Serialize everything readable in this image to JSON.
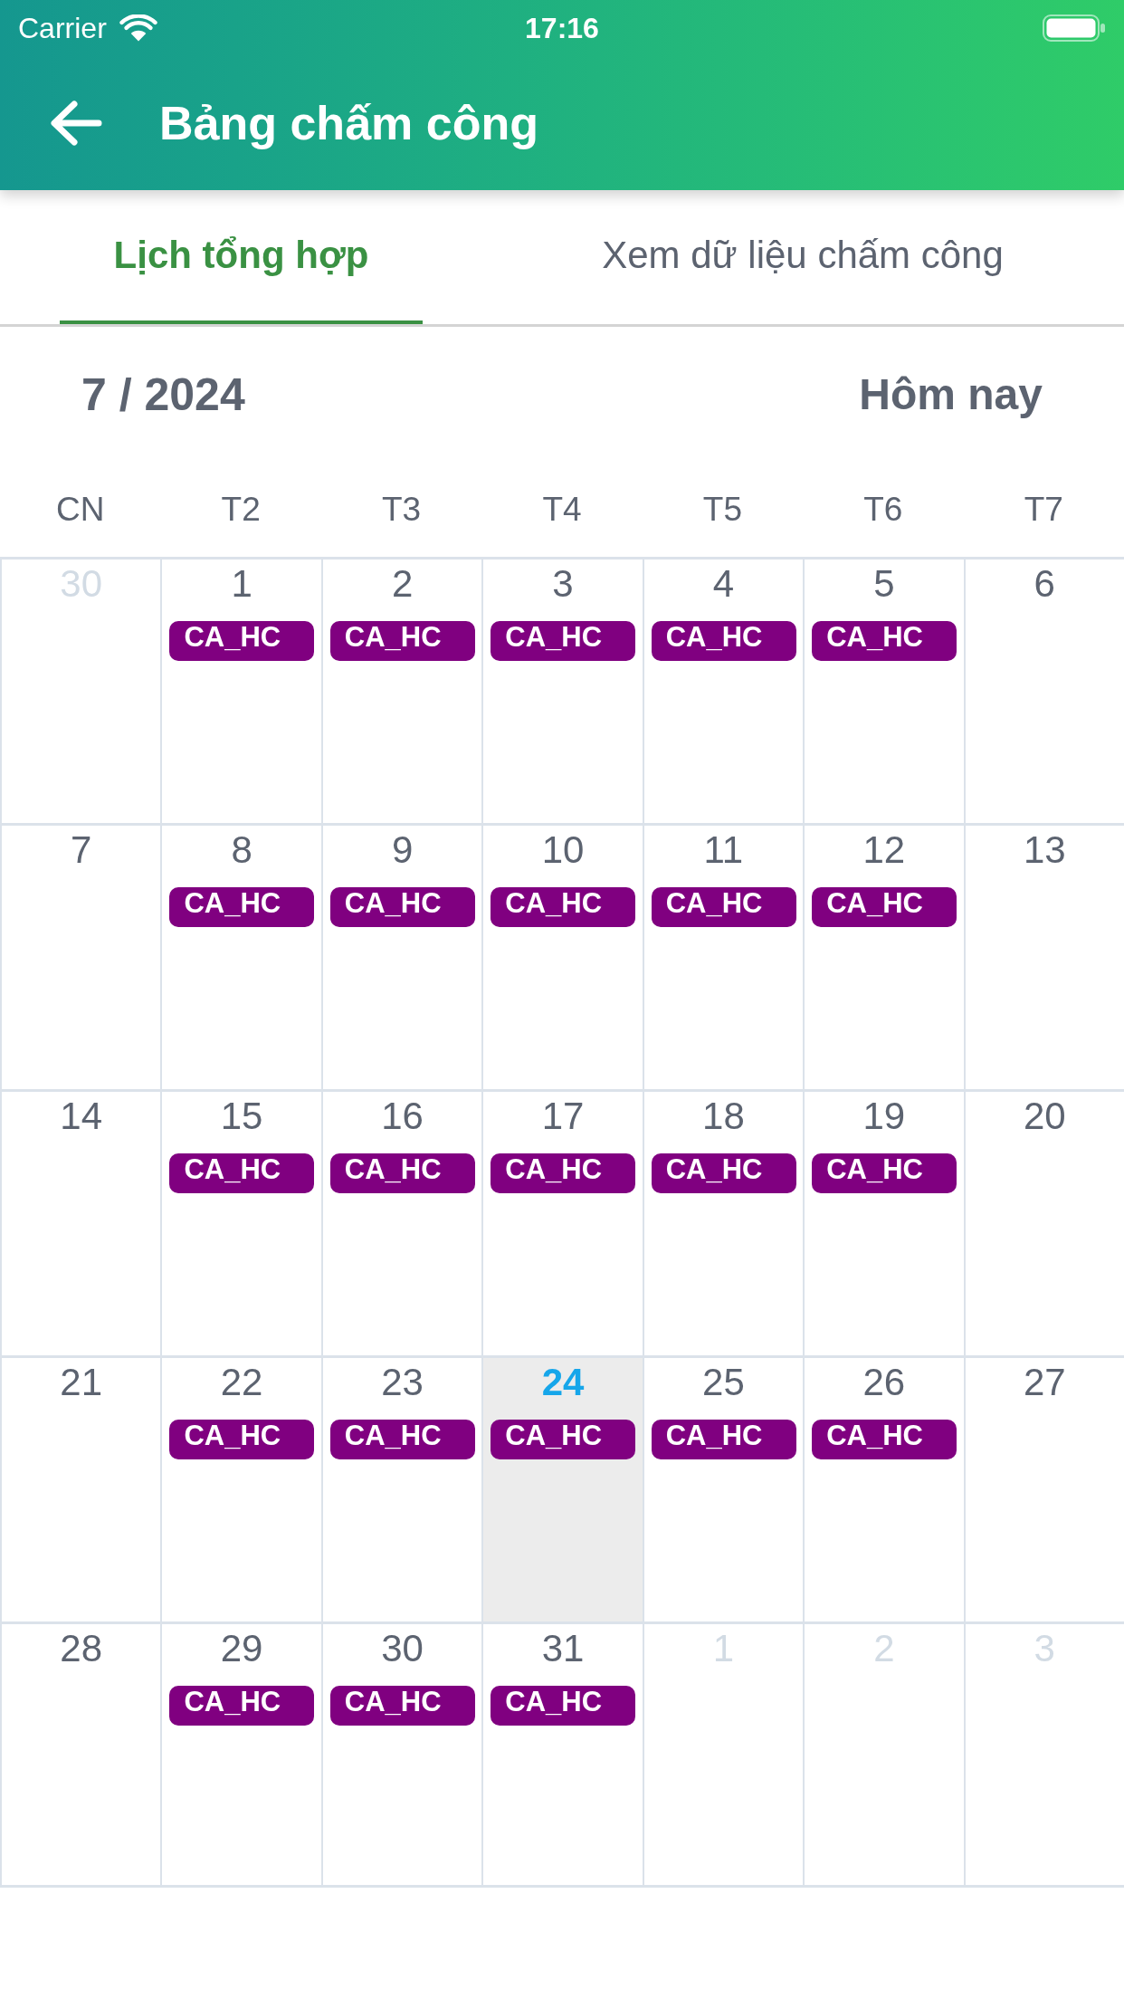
{
  "status_bar": {
    "carrier": "Carrier",
    "time": "17:16"
  },
  "header": {
    "title": "Bảng chấm công"
  },
  "tabs": [
    {
      "label": "Lịch tổng hợp",
      "selected": true
    },
    {
      "label": "Xem dữ liệu chấm công",
      "selected": false
    }
  ],
  "calendar": {
    "month": "7 / 2024",
    "today_button": "Hôm nay",
    "weekdays": [
      "CN",
      "T2",
      "T3",
      "T4",
      "T5",
      "T6",
      "T7"
    ],
    "weeks": [
      {
        "days": [
          {
            "day": "30",
            "in_month": false,
            "today": false
          },
          {
            "day": "1",
            "in_month": true,
            "today": false,
            "shifts": [
              "CA_HC"
            ]
          },
          {
            "day": "2",
            "in_month": true,
            "today": false,
            "shifts": [
              "CA_HC"
            ]
          },
          {
            "day": "3",
            "in_month": true,
            "today": false,
            "shifts": [
              "CA_HC"
            ]
          },
          {
            "day": "4",
            "in_month": true,
            "today": false,
            "shifts": [
              "CA_HC"
            ]
          },
          {
            "day": "5",
            "in_month": true,
            "today": false,
            "shifts": [
              "CA_HC"
            ]
          },
          {
            "day": "6",
            "in_month": true,
            "today": false
          }
        ]
      },
      {
        "days": [
          {
            "day": "7",
            "in_month": true,
            "today": false
          },
          {
            "day": "8",
            "in_month": true,
            "today": false,
            "shifts": [
              "CA_HC"
            ]
          },
          {
            "day": "9",
            "in_month": true,
            "today": false,
            "shifts": [
              "CA_HC"
            ]
          },
          {
            "day": "10",
            "in_month": true,
            "today": false,
            "shifts": [
              "CA_HC"
            ]
          },
          {
            "day": "11",
            "in_month": true,
            "today": false,
            "shifts": [
              "CA_HC"
            ]
          },
          {
            "day": "12",
            "in_month": true,
            "today": false,
            "shifts": [
              "CA_HC"
            ]
          },
          {
            "day": "13",
            "in_month": true,
            "today": false
          }
        ]
      },
      {
        "days": [
          {
            "day": "14",
            "in_month": true,
            "today": false
          },
          {
            "day": "15",
            "in_month": true,
            "today": false,
            "shifts": [
              "CA_HC"
            ]
          },
          {
            "day": "16",
            "in_month": true,
            "today": false,
            "shifts": [
              "CA_HC"
            ]
          },
          {
            "day": "17",
            "in_month": true,
            "today": false,
            "shifts": [
              "CA_HC"
            ]
          },
          {
            "day": "18",
            "in_month": true,
            "today": false,
            "shifts": [
              "CA_HC"
            ]
          },
          {
            "day": "19",
            "in_month": true,
            "today": false,
            "shifts": [
              "CA_HC"
            ]
          },
          {
            "day": "20",
            "in_month": true,
            "today": false
          }
        ]
      },
      {
        "days": [
          {
            "day": "21",
            "in_month": true,
            "today": false
          },
          {
            "day": "22",
            "in_month": true,
            "today": false,
            "shifts": [
              "CA_HC"
            ]
          },
          {
            "day": "23",
            "in_month": true,
            "today": false,
            "shifts": [
              "CA_HC"
            ]
          },
          {
            "day": "24",
            "in_month": true,
            "today": true,
            "shifts": [
              "CA_HC"
            ]
          },
          {
            "day": "25",
            "in_month": true,
            "today": false,
            "shifts": [
              "CA_HC"
            ]
          },
          {
            "day": "26",
            "in_month": true,
            "today": false,
            "shifts": [
              "CA_HC"
            ]
          },
          {
            "day": "27",
            "in_month": true,
            "today": false
          }
        ]
      },
      {
        "days": [
          {
            "day": "28",
            "in_month": true,
            "today": false
          },
          {
            "day": "29",
            "in_month": true,
            "today": false,
            "shifts": [
              "CA_HC"
            ]
          },
          {
            "day": "30",
            "in_month": true,
            "today": false,
            "shifts": [
              "CA_HC"
            ]
          },
          {
            "day": "31",
            "in_month": true,
            "today": false,
            "shifts": [
              "CA_HC"
            ]
          },
          {
            "day": "1",
            "in_month": false,
            "today": false
          },
          {
            "day": "2",
            "in_month": false,
            "today": false
          },
          {
            "day": "3",
            "in_month": false,
            "today": false
          }
        ]
      }
    ]
  }
}
